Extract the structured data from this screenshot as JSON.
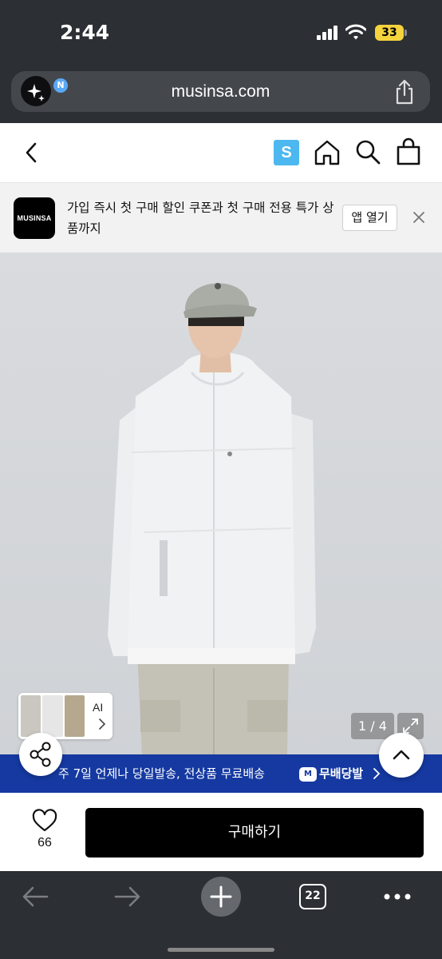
{
  "status_bar": {
    "time": "2:44",
    "battery": "33",
    "battery_color": "#f5d33c"
  },
  "browser": {
    "url": "musinsa.com",
    "ai_badge_letter": "N",
    "tab_count": "22",
    "icons": [
      "back-arrow-icon",
      "forward-arrow-icon",
      "plus-icon",
      "tabs-icon",
      "more-icon",
      "share-icon"
    ]
  },
  "site_header": {
    "s_badge": "S",
    "s_badge_color": "#4db8ef",
    "icons": [
      "chevron-left-icon",
      "home-icon",
      "search-icon",
      "shopping-bag-icon"
    ]
  },
  "app_banner": {
    "logo_text": "MUSINSA",
    "message": "가입 즉시 첫 구매 할인 쿠폰과 첫 구매 전용 특가 상품까지",
    "open_app_label": "앱 열기"
  },
  "product_image": {
    "ai_label": "AI",
    "page_counter": "1 / 4",
    "current_page": 1,
    "total_pages": 4
  },
  "shipping_strip": {
    "text": "주 7일 언제나 당일발송, 전상품 무료배송",
    "badge_icon_text": "M",
    "badge_label": "무배당발",
    "color": "#1539a1"
  },
  "purchase_bar": {
    "like_count": "66",
    "buy_label": "구매하기"
  }
}
